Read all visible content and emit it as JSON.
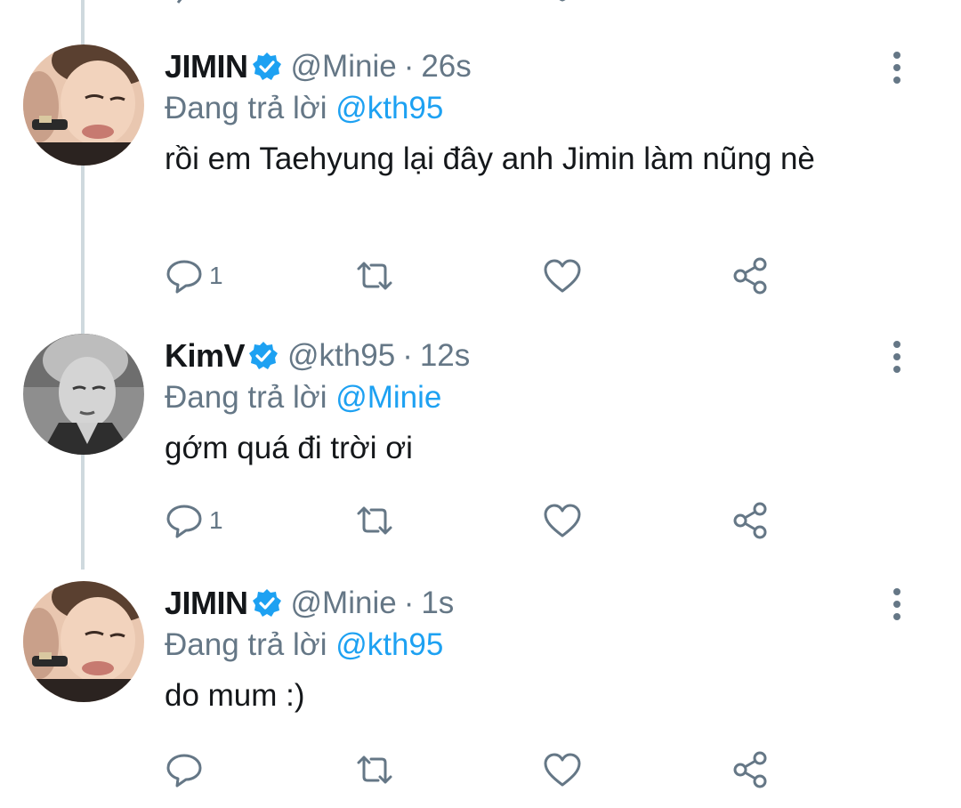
{
  "colors": {
    "link": "#1da1f2",
    "muted": "#657786",
    "text": "#14171a",
    "verified": "#1da1f2",
    "thread_line": "#cfd9de"
  },
  "tweets": [
    {
      "name": "JIMIN",
      "handle": "@Minie",
      "separator": "·",
      "time": "26s",
      "replying_prefix": "Đang trả lời",
      "replying_to": "@kth95",
      "text": "rồi em Taehyung lại đây anh Jimin làm nũng nè",
      "reply_count": "1",
      "avatar": "jimin-avatar",
      "verified": true
    },
    {
      "name": "KimV",
      "handle": "@kth95",
      "separator": "·",
      "time": "12s",
      "replying_prefix": "Đang trả lời",
      "replying_to": "@Minie",
      "text": "gớm quá đi trời ơi",
      "reply_count": "1",
      "avatar": "kimv-avatar",
      "verified": true
    },
    {
      "name": "JIMIN",
      "handle": "@Minie",
      "separator": "·",
      "time": "1s",
      "replying_prefix": "Đang trả lời",
      "replying_to": "@kth95",
      "text": "do mum :)",
      "reply_count": "",
      "avatar": "jimin-avatar",
      "verified": true
    }
  ],
  "icons": {
    "reply": "reply-icon",
    "retweet": "retweet-icon",
    "like": "heart-icon",
    "share": "share-icon",
    "more": "more-vertical-icon",
    "verified": "verified-badge-icon"
  }
}
